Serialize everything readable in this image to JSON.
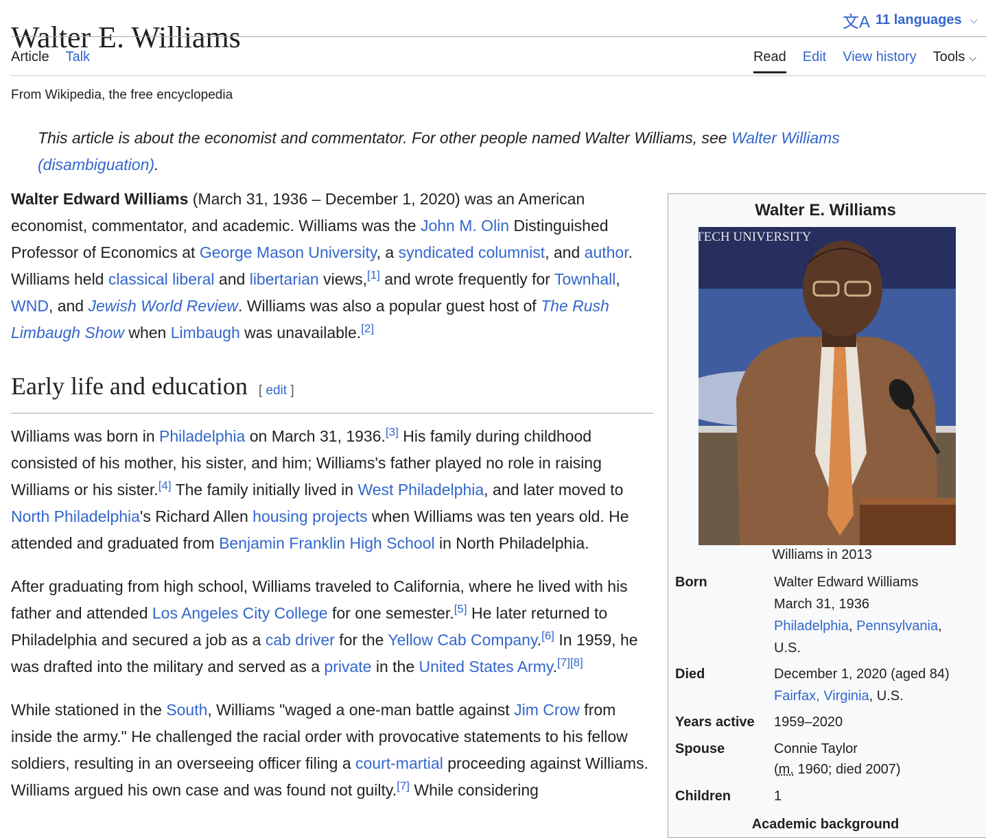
{
  "page": {
    "title": "Walter E. Williams",
    "languages_label": "11 languages",
    "tagline": "From Wikipedia, the free encyclopedia"
  },
  "tabs": {
    "left": [
      "Article",
      "Talk"
    ],
    "right": [
      "Read",
      "Edit",
      "View history",
      "Tools"
    ]
  },
  "hatnote": {
    "text": "This article is about the economist and commentator. For other people named Walter Williams, see ",
    "link": "Walter Williams (disambiguation)",
    "end": "."
  },
  "lead": {
    "bold_name": "Walter Edward Williams",
    "t1": " (March 31, 1936 – December 1, 2020) was an American economist, commentator, and academic. Williams was the ",
    "l_olin": "John M. Olin",
    "t2": " Distinguished Professor of Economics at ",
    "l_gmu": "George Mason University",
    "t3": ", a ",
    "l_synd": "syndicated columnist",
    "t4": ", and ",
    "l_author": "author",
    "t5": ". Williams held ",
    "l_classical": "classical liberal",
    "t6": " and ",
    "l_libertarian": "libertarian",
    "t7": " views,",
    "ref1": "[1]",
    "t8": " and wrote frequently for ",
    "l_townhall": "Townhall",
    "t9": ", ",
    "l_wnd": "WND",
    "t10": ", and ",
    "l_jwr": "Jewish World Review",
    "t11": ". Williams was also a popular guest host of ",
    "l_rush": "The Rush Limbaugh Show",
    "t12": " when ",
    "l_limbaugh": "Limbaugh",
    "t13": " was unavailable.",
    "ref2": "[2]"
  },
  "section1": {
    "heading": "Early life and education",
    "edit": "edit"
  },
  "p1": {
    "t1": "Williams was born in ",
    "l_phila": "Philadelphia",
    "t2": " on March 31, 1936.",
    "ref3": "[3]",
    "t3": " His family during childhood consisted of his mother, his sister, and him; Williams's father played no role in raising Williams or his sister.",
    "ref4": "[4]",
    "t4": " The family initially lived in ",
    "l_west": "West Philadelphia",
    "t5": ", and later moved to ",
    "l_north": "North Philadelphia",
    "t6": "'s Richard Allen ",
    "l_housing": "housing projects",
    "t7": " when Williams was ten years old. He attended and graduated from ",
    "l_bfhs": "Benjamin Franklin High School",
    "t8": " in North Philadelphia."
  },
  "p2": {
    "t1": "After graduating from high school, Williams traveled to California, where he lived with his father and attended ",
    "l_lacc": "Los Angeles City College",
    "t2": " for one semester.",
    "ref5": "[5]",
    "t3": " He later returned to Philadelphia and secured a job as a ",
    "l_cab": "cab driver",
    "t4": " for the ",
    "l_yellow": "Yellow Cab Company",
    "t5": ".",
    "ref6": "[6]",
    "t6": " In 1959, he was drafted into the military and served as a ",
    "l_private": "private",
    "t7": " in the ",
    "l_army": "United States Army",
    "t8": ".",
    "ref7": "[7]",
    "ref8": "[8]"
  },
  "p3": {
    "t1": "While stationed in the ",
    "l_south": "South",
    "t2": ", Williams \"waged a one-man battle against ",
    "l_jimcrow": "Jim Crow",
    "t3": " from inside the army.\" He challenged the racial order with provocative statements to his fellow soldiers, resulting in an overseeing officer filing a ",
    "l_court": "court-martial",
    "t4": " proceeding against Williams. Williams argued his own case and was found not guilty.",
    "ref7": "[7]",
    "t5": " While considering"
  },
  "infobox": {
    "title": "Walter E. Williams",
    "photo_sign": "TECH UNIVERSITY",
    "caption": "Williams in 2013",
    "born_label": "Born",
    "born_name": "Walter Edward Williams",
    "born_date": "March 31, 1936",
    "born_city": "Philadelphia",
    "born_state": "Pennsylvania",
    "born_country": "U.S.",
    "died_label": "Died",
    "died_date": "December 1, 2020 (aged 84)",
    "died_place": "Fairfax, Virginia",
    "died_country": ", U.S.",
    "years_label": "Years active",
    "years_value": "1959–2020",
    "spouse_label": "Spouse",
    "spouse_name": "Connie Taylor",
    "spouse_m": "m.",
    "spouse_detail": " 1960; died 2007)",
    "children_label": "Children",
    "children_value": "1",
    "academic_heading": "Academic background"
  }
}
